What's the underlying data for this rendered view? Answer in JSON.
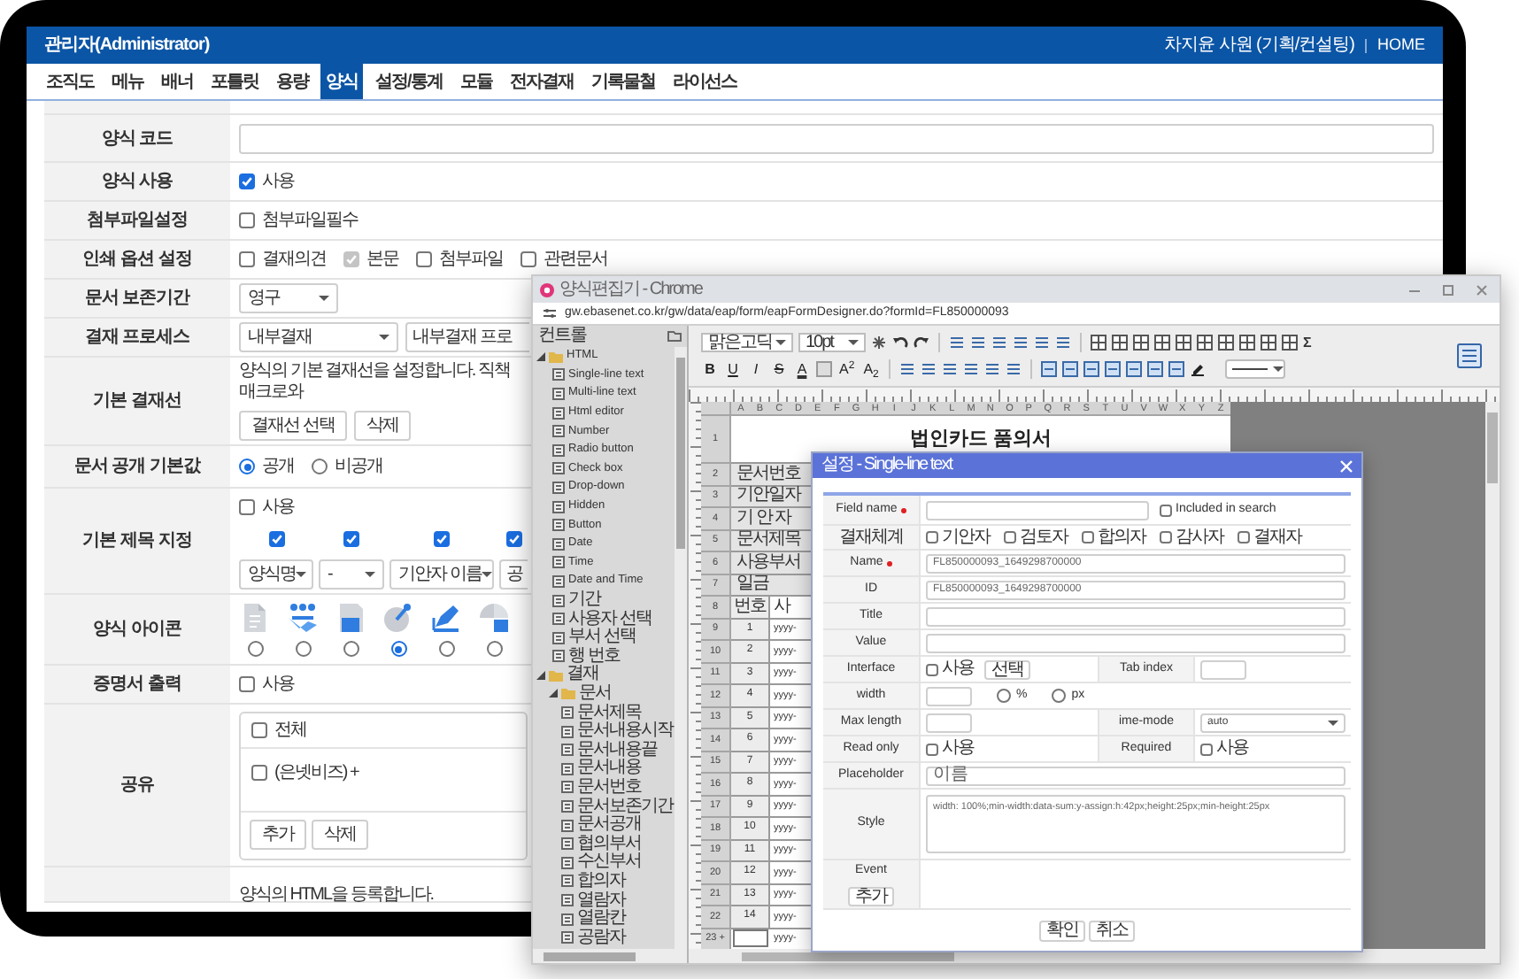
{
  "admin": {
    "header": {
      "title": "관리자(Administrator)",
      "user": "차지윤 사원 (기획/컨설팅)",
      "home": "HOME"
    },
    "nav": [
      {
        "label": "조직도",
        "selected": false
      },
      {
        "label": "메뉴",
        "selected": false
      },
      {
        "label": "배너",
        "selected": false
      },
      {
        "label": "포틀릿",
        "selected": false
      },
      {
        "label": "용량",
        "selected": false
      },
      {
        "label": "양식",
        "selected": true
      },
      {
        "label": "설정/통계",
        "selected": false
      },
      {
        "label": "모듈",
        "selected": false
      },
      {
        "label": "전자결재",
        "selected": false
      },
      {
        "label": "기록물철",
        "selected": false
      },
      {
        "label": "라이선스",
        "selected": false
      }
    ],
    "rows": [
      {
        "label": "양식 코드",
        "kind": "input"
      },
      {
        "label": "양식 사용",
        "kind": "checks",
        "options": [
          {
            "label": "사용",
            "checked": true
          }
        ]
      },
      {
        "label": "첨부파일설정",
        "kind": "checks",
        "options": [
          {
            "label": "첨부파일필수",
            "checked": false
          }
        ]
      },
      {
        "label": "인쇄 옵션 설정",
        "kind": "checks",
        "options": [
          {
            "label": "결재의견",
            "checked": false,
            "disabled": false
          },
          {
            "label": "본문",
            "checked": true,
            "disabled": true
          },
          {
            "label": "첨부파일",
            "checked": false,
            "disabled": false
          },
          {
            "label": "관련문서",
            "checked": false,
            "disabled": false
          }
        ]
      },
      {
        "label": "문서 보존기간",
        "kind": "selects",
        "selects": [
          {
            "value": "영구",
            "truncated": false
          }
        ]
      },
      {
        "label": "결재 프로세스",
        "kind": "selects",
        "selects": [
          {
            "value": "내부결재",
            "truncated": false
          },
          {
            "value": "내부결재 프로",
            "truncated": true
          }
        ]
      },
      {
        "label": "기본 결재선",
        "kind": "approval",
        "text": "양식의 기본 결재선을 설정합니다. 직책 매크로와",
        "buttons": [
          "결재선 선택",
          "삭제"
        ]
      },
      {
        "label": "문서 공개 기본값",
        "kind": "radios",
        "options": [
          {
            "label": "공개",
            "selected": true
          },
          {
            "label": "비공개",
            "selected": false
          }
        ]
      },
      {
        "label": "기본 제목 지정",
        "kind": "title",
        "use": {
          "label": "사용",
          "checked": false
        },
        "parts": [
          {
            "value": "양식명",
            "checked": true,
            "truncated": false
          },
          {
            "value": "-",
            "checked": true,
            "truncated": false
          },
          {
            "value": "기안자 이름",
            "checked": true,
            "truncated": false
          },
          {
            "value": "공",
            "checked": true,
            "truncated": true
          }
        ]
      },
      {
        "label": "양식 아이콘",
        "kind": "icons",
        "icons": [
          {
            "selected": false
          },
          {
            "selected": false
          },
          {
            "selected": false
          },
          {
            "selected": true
          },
          {
            "selected": false
          },
          {
            "selected": false
          }
        ]
      },
      {
        "label": "증명서 출력",
        "kind": "checks",
        "options": [
          {
            "label": "사용",
            "checked": false
          }
        ]
      },
      {
        "label": "공유",
        "kind": "share",
        "all": {
          "label": "전체",
          "checked": false
        },
        "items": [
          {
            "label": "(은넷비즈) +",
            "checked": false
          }
        ],
        "buttons": [
          "추가",
          "삭제"
        ]
      },
      {
        "kind": "note",
        "text": "양식의 HTML을 등록합니다."
      }
    ]
  },
  "editor_window": {
    "title": "양식편집기 - Chrome",
    "url": "gw.ebasenet.co.kr/gw/data/eap/form/eapFormDesigner.do?formId=FL850000093",
    "controls_panel": {
      "title": "컨트롤",
      "tree": [
        {
          "label": "HTML",
          "expanded": true,
          "children": [
            {
              "label": "Single-line text"
            },
            {
              "label": "Multi-line text"
            },
            {
              "label": "Html editor"
            },
            {
              "label": "Number"
            },
            {
              "label": "Radio button"
            },
            {
              "label": "Check box"
            },
            {
              "label": "Drop-down"
            },
            {
              "label": "Hidden"
            },
            {
              "label": "Button"
            },
            {
              "label": "Date"
            },
            {
              "label": "Time"
            },
            {
              "label": "Date and Time"
            },
            {
              "label": "기간"
            },
            {
              "label": "사용자 선택"
            },
            {
              "label": "부서 선택"
            },
            {
              "label": "행 번호"
            }
          ]
        },
        {
          "label": "결재",
          "expanded": true,
          "children": [
            {
              "label": "문서",
              "expanded": true,
              "children": [
                {
                  "label": "문서제목"
                },
                {
                  "label": "문서내용시작"
                },
                {
                  "label": "문서내용끝"
                },
                {
                  "label": "문서내용"
                },
                {
                  "label": "문서번호"
                },
                {
                  "label": "문서보존기간"
                },
                {
                  "label": "문서공개"
                },
                {
                  "label": "협의부서"
                },
                {
                  "label": "수신부서"
                },
                {
                  "label": "합의자"
                },
                {
                  "label": "열람자"
                },
                {
                  "label": "열람칸"
                },
                {
                  "label": "공람자"
                }
              ]
            }
          ]
        }
      ]
    },
    "toolbar": {
      "font": "맑은고딕",
      "size": "10pt",
      "format_buttons": [
        "B",
        "U",
        "I",
        "S",
        "A"
      ],
      "script_buttons": [
        "A$^{2}$",
        "A$_{2}$"
      ],
      "sum_button": "Σ"
    },
    "sheet": {
      "title": "법인카드 품의서",
      "columns": [
        "A",
        "B",
        "C",
        "D",
        "E",
        "F",
        "G",
        "H",
        "I",
        "J",
        "K",
        "L",
        "M",
        "N",
        "O",
        "P",
        "Q",
        "R",
        "S",
        "T",
        "U",
        "V",
        "W",
        "X",
        "Y",
        "Z"
      ],
      "rows": [
        {
          "number": "1",
          "kind": "title"
        },
        {
          "number": "2",
          "kind": "label",
          "cells": [
            "문서번호"
          ]
        },
        {
          "number": "3",
          "kind": "label",
          "cells": [
            "기안일자"
          ]
        },
        {
          "number": "4",
          "kind": "label",
          "cells": [
            "기 안 자"
          ]
        },
        {
          "number": "5",
          "kind": "label",
          "cells": [
            "문서제목"
          ]
        },
        {
          "number": "6",
          "kind": "label",
          "cells": [
            "사용부서"
          ]
        },
        {
          "number": "7",
          "kind": "label",
          "cells": [
            "일금"
          ]
        },
        {
          "number": "8",
          "kind": "pair",
          "cells": [
            "번호",
            "사"
          ]
        },
        {
          "number": "9",
          "kind": "pair",
          "cells": [
            "1",
            "yyyy-"
          ]
        },
        {
          "number": "10",
          "kind": "pair",
          "cells": [
            "2",
            "yyyy-"
          ]
        },
        {
          "number": "11",
          "kind": "pair",
          "cells": [
            "3",
            "yyyy-"
          ]
        },
        {
          "number": "12",
          "kind": "pair",
          "cells": [
            "4",
            "yyyy-"
          ]
        },
        {
          "number": "13",
          "kind": "pair",
          "cells": [
            "5",
            "yyyy-"
          ]
        },
        {
          "number": "14",
          "kind": "pair",
          "cells": [
            "6",
            "yyyy-"
          ]
        },
        {
          "number": "15",
          "kind": "pair",
          "cells": [
            "7",
            "yyyy-"
          ]
        },
        {
          "number": "16",
          "kind": "pair",
          "cells": [
            "8",
            "yyyy-"
          ]
        },
        {
          "number": "17",
          "kind": "pair",
          "cells": [
            "9",
            "yyyy-"
          ]
        },
        {
          "number": "18",
          "kind": "pair",
          "cells": [
            "10",
            "yyyy-"
          ]
        },
        {
          "number": "19",
          "kind": "pair",
          "cells": [
            "11",
            "yyyy-"
          ]
        },
        {
          "number": "20",
          "kind": "pair",
          "cells": [
            "12",
            "yyyy-"
          ]
        },
        {
          "number": "21",
          "kind": "pair",
          "cells": [
            "13",
            "yyyy-"
          ]
        },
        {
          "number": "22",
          "kind": "pair",
          "cells": [
            "14",
            "yyyy-"
          ]
        },
        {
          "number": "23 +",
          "kind": "tail",
          "cells": [
            "yyyy-"
          ]
        }
      ]
    }
  },
  "dialog": {
    "title": "설정 - Single-line text",
    "rows": [
      {
        "cells": [
          {
            "label": "Field name",
            "required": true,
            "kind": "text_check",
            "check": {
              "label": "Included in search",
              "checked": false
            }
          }
        ]
      },
      {
        "cells": [
          {
            "label": "결재체계",
            "required": false,
            "kind": "checks",
            "options": [
              {
                "label": "기안자",
                "checked": false
              },
              {
                "label": "검토자",
                "checked": false
              },
              {
                "label": "합의자",
                "checked": false
              },
              {
                "label": "감사자",
                "checked": false
              },
              {
                "label": "결재자",
                "checked": false
              }
            ]
          }
        ]
      },
      {
        "cells": [
          {
            "label": "Name",
            "required": true,
            "kind": "text",
            "value": "FL850000093_1649298700000"
          }
        ]
      },
      {
        "cells": [
          {
            "label": "ID",
            "required": false,
            "kind": "text",
            "value": "FL850000093_1649298700000"
          }
        ]
      },
      {
        "cells": [
          {
            "label": "Title",
            "required": false,
            "kind": "text"
          }
        ]
      },
      {
        "cells": [
          {
            "label": "Value",
            "required": false,
            "kind": "text"
          }
        ]
      },
      {
        "cells": [
          {
            "label": "Interface",
            "required": false,
            "kind": "check_button",
            "check": {
              "label": "사용",
              "checked": false
            },
            "button": "선택"
          },
          {
            "label": "Tab index",
            "required": false,
            "kind": "small_input"
          }
        ]
      },
      {
        "cells": [
          {
            "label": "width",
            "required": false,
            "kind": "width",
            "radios": [
              {
                "label": "%",
                "selected": false
              },
              {
                "label": "px",
                "selected": false
              }
            ]
          }
        ]
      },
      {
        "cells": [
          {
            "label": "Max length",
            "required": false,
            "kind": "small_input"
          },
          {
            "label": "ime-mode",
            "required": false,
            "kind": "select",
            "value": "auto"
          }
        ]
      },
      {
        "cells": [
          {
            "label": "Read only",
            "required": false,
            "kind": "check",
            "check": {
              "label": "사용",
              "checked": false
            }
          },
          {
            "label": "Required",
            "required": false,
            "kind": "check",
            "check": {
              "label": "사용",
              "checked": false
            }
          }
        ]
      },
      {
        "cells": [
          {
            "label": "Placeholder",
            "required": false,
            "kind": "text",
            "value": "이름"
          }
        ]
      },
      {
        "cells": [
          {
            "label": "Style",
            "required": false,
            "kind": "textarea",
            "value": "width: 100%;min-width:data-sum:y-assign:h:42px;height:25px;min-height:25px"
          }
        ]
      },
      {
        "cells": [
          {
            "label": "Event",
            "required": false,
            "kind": "event",
            "button": "추가"
          }
        ]
      }
    ],
    "buttons": [
      "확인",
      "취소"
    ]
  }
}
